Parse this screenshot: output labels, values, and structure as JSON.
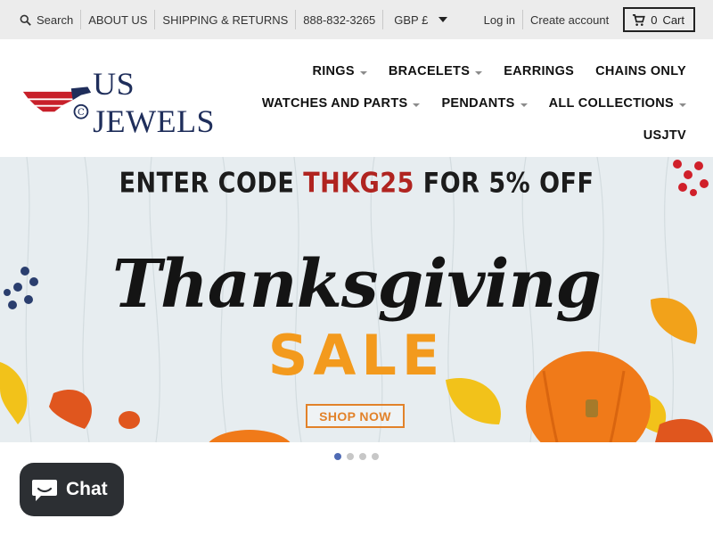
{
  "topbar": {
    "search_label": "Search",
    "links": [
      "ABOUT US",
      "SHIPPING & RETURNS",
      "888-832-3265"
    ],
    "currency": "GBP £",
    "login": "Log in",
    "create_account": "Create account",
    "cart_count": "0",
    "cart_label": "Cart"
  },
  "header": {
    "logo_text": "US JEWELS",
    "nav_rows": [
      [
        {
          "label": "RINGS",
          "dropdown": true
        },
        {
          "label": "BRACELETS",
          "dropdown": true
        },
        {
          "label": "EARRINGS",
          "dropdown": false
        },
        {
          "label": "CHAINS ONLY",
          "dropdown": false
        }
      ],
      [
        {
          "label": "WATCHES AND PARTS",
          "dropdown": true
        },
        {
          "label": "PENDANTS",
          "dropdown": true
        },
        {
          "label": "ALL COLLECTIONS",
          "dropdown": true
        }
      ],
      [
        {
          "label": "USJTV",
          "dropdown": false
        }
      ]
    ]
  },
  "banner": {
    "promo_prefix": "ENTER CODE",
    "promo_code": "THKG25",
    "promo_suffix": "FOR 5% OFF",
    "headline": "Thanksgiving",
    "sale": "SALE",
    "cta": "SHOP NOW"
  },
  "slider": {
    "slides": 4,
    "active": 1
  },
  "chat": {
    "label": "Chat"
  },
  "colors": {
    "accent": "#4f6bb4",
    "promo_code": "#b02420",
    "sale": "#f39a1d",
    "logo_navy": "#1f2e5b",
    "logo_red": "#c8202a"
  }
}
